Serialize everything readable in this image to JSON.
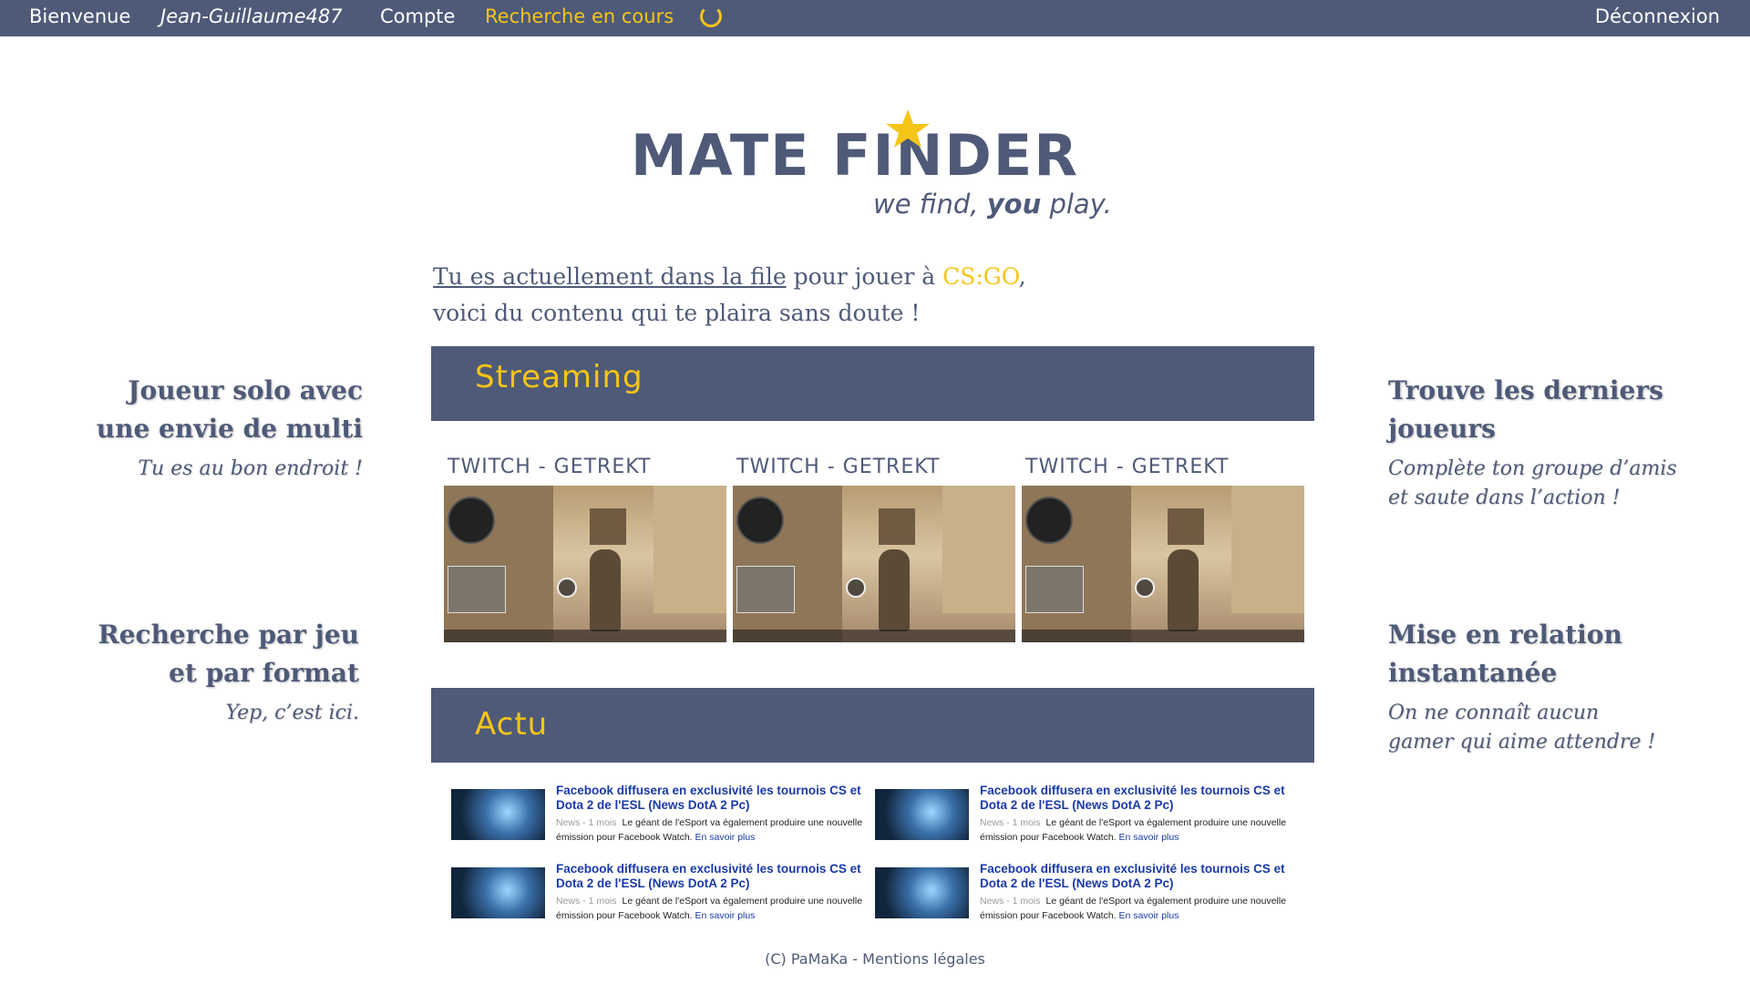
{
  "nav": {
    "home": "Bienvenue",
    "user": "Jean-Guillaume487",
    "account": "Compte",
    "search_status": "Recherche en cours",
    "logout": "Déconnexion"
  },
  "logo": {
    "name": "MATE FINDER",
    "tagline_a": "we find, ",
    "tagline_b": "you",
    "tagline_c": " play."
  },
  "intro": {
    "link": "Tu es actuellement dans la file",
    "middle": " pour jouer à ",
    "game": "CS:GO",
    "end": ",",
    "line2": "voici du contenu qui te plaira sans doute !"
  },
  "left": [
    {
      "title1": "Joueur solo avec",
      "title2": "une envie de multi",
      "sub": "Tu es au bon endroit !"
    },
    {
      "title1": "Recherche par jeu",
      "title2": "et par format",
      "sub": "Yep, c’est ici."
    }
  ],
  "right": [
    {
      "title1": "Trouve les derniers",
      "title2": "joueurs",
      "sub1": "Complète ton groupe d’amis",
      "sub2": "et saute dans l’action !"
    },
    {
      "title1": "Mise en relation",
      "title2": "instantanée",
      "sub1": "On ne connaît aucun",
      "sub2": "gamer qui aime attendre !"
    }
  ],
  "streaming": {
    "title": "Streaming",
    "items": [
      {
        "label": "TWITCH - GETREKT"
      },
      {
        "label": "TWITCH - GETREKT"
      },
      {
        "label": "TWITCH - GETREKT"
      }
    ]
  },
  "news": {
    "title": "Actu",
    "items": [
      {
        "title": "Facebook diffusera en exclusivité les tournois CS et Dota 2 de l'ESL (News DotA 2 Pc)",
        "meta": "News - 1 mois",
        "text": "Le géant de l'eSport va également produire une nouvelle émission pour Facebook Watch.",
        "more": "En savoir plus"
      },
      {
        "title": "Facebook diffusera en exclusivité les tournois CS et Dota 2 de l'ESL (News DotA 2 Pc)",
        "meta": "News - 1 mois",
        "text": "Le géant de l'eSport va également produire une nouvelle émission pour Facebook Watch.",
        "more": "En savoir plus"
      },
      {
        "title": "Facebook diffusera en exclusivité les tournois CS et Dota 2 de l'ESL (News DotA 2 Pc)",
        "meta": "News - 1 mois",
        "text": "Le géant de l'eSport va également produire une nouvelle émission pour Facebook Watch.",
        "more": "En savoir plus"
      },
      {
        "title": "Facebook diffusera en exclusivité les tournois CS et Dota 2 de l'ESL (News DotA 2 Pc)",
        "meta": "News - 1 mois",
        "text": "Le géant de l'eSport va également produire une nouvelle émission pour Facebook Watch.",
        "more": "En savoir plus"
      }
    ]
  },
  "footer": {
    "text": "(C) PaMaKa - Mentions légales"
  },
  "colors": {
    "primary": "#4e5a78",
    "accent": "#f5c518",
    "link": "#1a3aa8"
  },
  "icons": {
    "spinner": "loading-spinner-icon",
    "star": "star-icon"
  }
}
